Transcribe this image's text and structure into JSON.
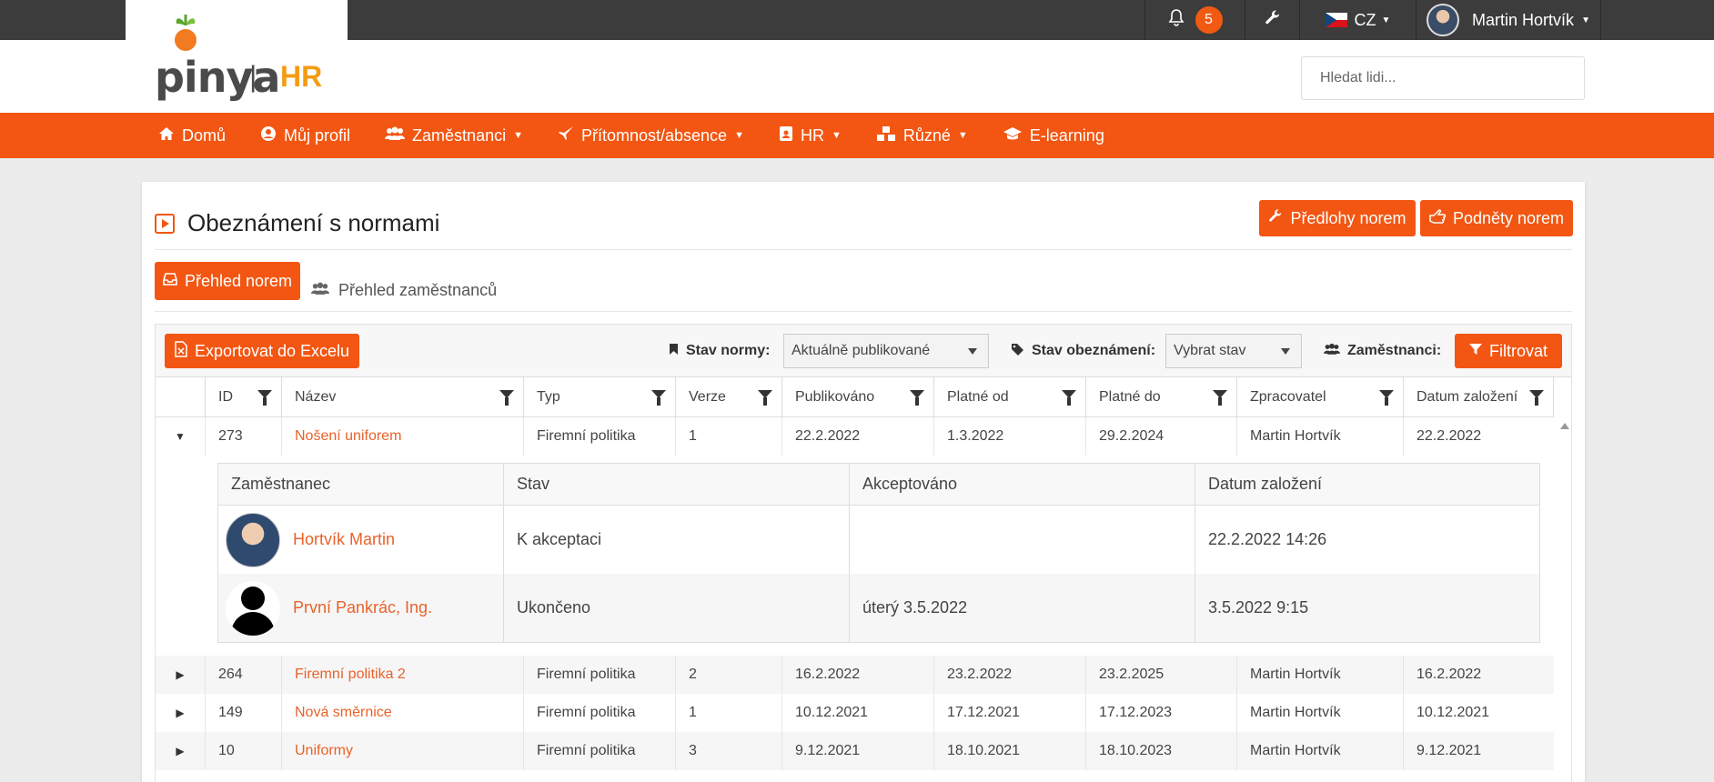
{
  "topbar": {
    "notifications_count": "5",
    "language": "CZ",
    "user_name": "Martin Hortvík"
  },
  "logo": {
    "word": "pinya",
    "separator": "|",
    "suffix": "HR"
  },
  "search": {
    "placeholder": "Hledat lidi..."
  },
  "nav": {
    "items": [
      {
        "label": "Domů"
      },
      {
        "label": "Můj profil"
      },
      {
        "label": "Zaměstnanci"
      },
      {
        "label": "Přítomnost/absence"
      },
      {
        "label": "HR"
      },
      {
        "label": "Různé"
      },
      {
        "label": "E-learning"
      }
    ]
  },
  "page": {
    "title": "Obeznámení s normami",
    "btn_templates": "Předlohy norem",
    "btn_suggestions": "Podněty norem",
    "tab_active": "Přehled norem",
    "tab_inactive": "Přehled zaměstnanců"
  },
  "filters": {
    "export_label": "Exportovat do Excelu",
    "stav_normy_label": "Stav normy:",
    "stav_normy_value": "Aktuálně publikované",
    "stav_obez_label": "Stav obeznámení:",
    "stav_obez_value": "Vybrat stav",
    "zamestnanci_label": "Zaměstnanci:",
    "filter_button": "Filtrovat"
  },
  "table": {
    "columns": [
      "ID",
      "Název",
      "Typ",
      "Verze",
      "Publikováno",
      "Platné od",
      "Platné do",
      "Zpracovatel",
      "Datum založení"
    ],
    "rows": [
      {
        "id": "273",
        "name": "Nošení uniforem",
        "type": "Firemní politika",
        "version": "1",
        "published": "22.2.2022",
        "valid_from": "1.3.2022",
        "valid_to": "29.2.2024",
        "processor": "Martin Hortvík",
        "created": "22.2.2022"
      },
      {
        "id": "264",
        "name": "Firemní politika 2",
        "type": "Firemní politika",
        "version": "2",
        "published": "16.2.2022",
        "valid_from": "23.2.2022",
        "valid_to": "23.2.2025",
        "processor": "Martin Hortvík",
        "created": "16.2.2022"
      },
      {
        "id": "149",
        "name": "Nová směrnice",
        "type": "Firemní politika",
        "version": "1",
        "published": "10.12.2021",
        "valid_from": "17.12.2021",
        "valid_to": "17.12.2023",
        "processor": "Martin Hortvík",
        "created": "10.12.2021"
      },
      {
        "id": "10",
        "name": "Uniformy",
        "type": "Firemní politika",
        "version": "3",
        "published": "9.12.2021",
        "valid_from": "18.10.2021",
        "valid_to": "18.10.2023",
        "processor": "Martin Hortvík",
        "created": "9.12.2021"
      }
    ]
  },
  "subtable": {
    "columns": [
      "Zaměstnanec",
      "Stav",
      "Akceptováno",
      "Datum založení"
    ],
    "rows": [
      {
        "employee": "Hortvík Martin",
        "state": "K akceptaci",
        "accepted": "",
        "created": "22.2.2022 14:26"
      },
      {
        "employee": "První Pankrác, Ing.",
        "state": "Ukončeno",
        "accepted": "úterý 3.5.2022",
        "created": "3.5.2022 9:15"
      }
    ]
  },
  "colors": {
    "accent": "#f25612",
    "link": "#e8622a",
    "topbar": "#3c3c3c"
  }
}
